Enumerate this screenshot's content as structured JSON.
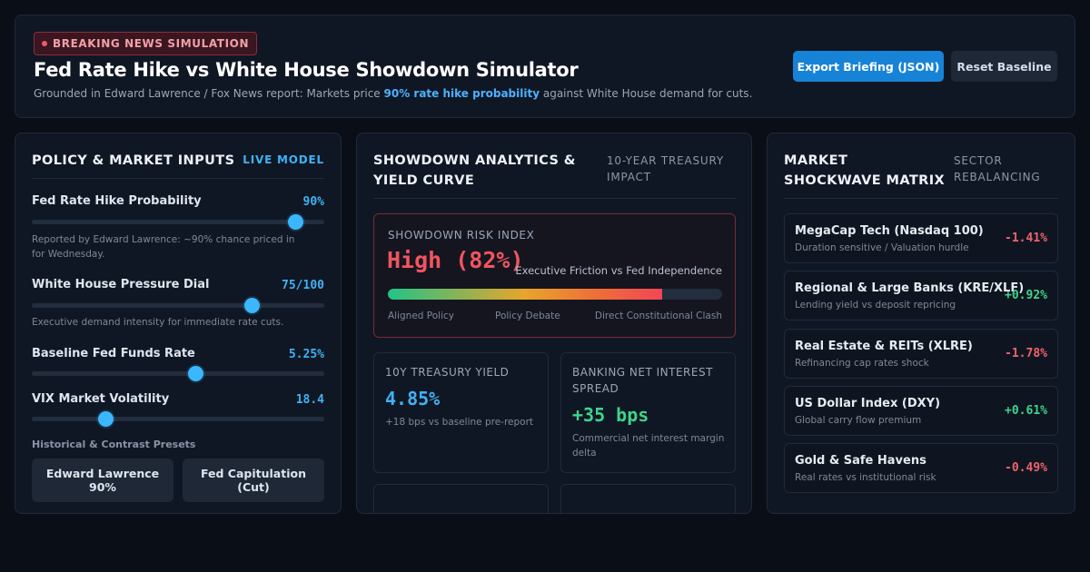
{
  "header": {
    "badge": "BREAKING NEWS SIMULATION",
    "title": "Fed Rate Hike vs White House Showdown Simulator",
    "subtitle_pre": "Grounded in Edward Lawrence / Fox News report: Markets price ",
    "subtitle_highlight": "90% rate hike probability",
    "subtitle_post": " against White House demand for cuts.",
    "export_label": "Export Briefing (JSON)",
    "reset_label": "Reset Baseline"
  },
  "inputs": {
    "title": "POLICY & MARKET INPUTS",
    "tag": "LIVE MODEL",
    "controls": [
      {
        "label": "Fed Rate Hike Probability",
        "value": "90%",
        "level": 0.9,
        "note": "Reported by Edward Lawrence: ~90% chance priced in for Wednesday."
      },
      {
        "label": "White House Pressure Dial",
        "value": "75/100",
        "level": 0.75,
        "note": "Executive demand intensity for immediate rate cuts."
      },
      {
        "label": "Baseline Fed Funds Rate",
        "value": "5.25%",
        "level": 0.56
      },
      {
        "label": "VIX Market Volatility",
        "value": "18.4",
        "level": 0.25
      }
    ],
    "presets_label": "Historical & Contrast Presets",
    "presets": [
      {
        "line1": "Edward Lawrence",
        "line2": "90%"
      },
      {
        "line1": "Fed Capitulation",
        "line2": "(Cut)"
      }
    ]
  },
  "analytics": {
    "title": "SHOWDOWN ANALYTICS & YIELD CURVE",
    "tag": "10-YEAR TREASURY IMPACT",
    "risk": {
      "label": "SHOWDOWN RISK INDEX",
      "value": "High (82%)",
      "level": 0.82,
      "caption": "Executive Friction vs Fed Independence",
      "scale": [
        "Aligned Policy",
        "Policy Debate",
        "Direct Constitutional Clash"
      ]
    },
    "cards": [
      {
        "label": "10Y TREASURY YIELD",
        "value": "4.85%",
        "note": "+18 bps vs baseline pre-report",
        "color": "#3fb2f5"
      },
      {
        "label": "BANKING NET INTEREST SPREAD",
        "value": "+35 bps",
        "note": "Commercial net interest margin delta",
        "color": "#3fd48c"
      }
    ]
  },
  "matrix": {
    "title": "MARKET SHOCKWAVE MATRIX",
    "tag": "SECTOR REBALANCING",
    "rows": [
      {
        "name": "MegaCap Tech (Nasdaq 100)",
        "sub": "Duration sensitive / Valuation hurdle",
        "change": "-1.41%",
        "dir": "neg"
      },
      {
        "name": "Regional & Large Banks (KRE/XLF)",
        "sub": "Lending yield vs deposit repricing",
        "change": "+0.92%",
        "dir": "pos"
      },
      {
        "name": "Real Estate & REITs (XLRE)",
        "sub": "Refinancing cap rates shock",
        "change": "-1.78%",
        "dir": "neg"
      },
      {
        "name": "US Dollar Index (DXY)",
        "sub": "Global carry flow premium",
        "change": "+0.61%",
        "dir": "pos"
      },
      {
        "name": "Gold & Safe Havens",
        "sub": "Real rates vs institutional risk",
        "change": "-0.49%",
        "dir": "neg"
      }
    ]
  }
}
